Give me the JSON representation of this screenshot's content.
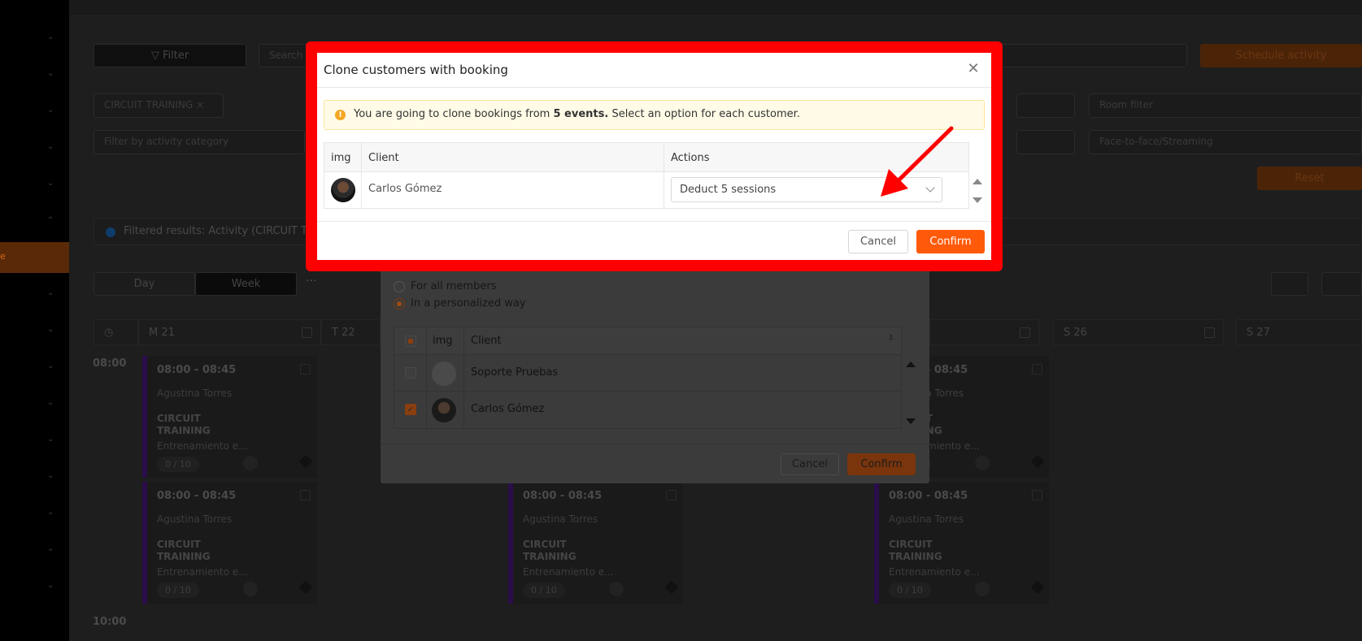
{
  "background": {
    "filter_button": "Filter",
    "search_placeholder": "Search",
    "schedule_button": "Schedule activity",
    "activity_chip": "CIRCUIT TRAINING ×",
    "category_placeholder": "Filter by activity category",
    "room_placeholder": "Room filter",
    "streaming_placeholder": "Face-to-face/Streaming",
    "reset_button": "Reset",
    "filtered_info": "Filtered results: Activity (CIRCUIT TRAINING)",
    "view_tabs": [
      "Day",
      "Week"
    ],
    "more_label": "···",
    "sidebar_active": "e",
    "day_headers": [
      "M 21",
      "T 22",
      "S 26",
      "S 27"
    ],
    "time_labels": [
      "08:00",
      "10:00"
    ],
    "event": {
      "time": "08:00 - 08:45",
      "trainer": "Agustina Torres",
      "title": "CIRCUIT TRAINING",
      "description": "Entrenamiento e...",
      "capacity": "0 / 10"
    }
  },
  "underlying_dialog": {
    "radio_all": "For all members",
    "radio_personalized": "In a personalized way",
    "columns": [
      "img",
      "Client"
    ],
    "rows": [
      {
        "client": "Soporte Pruebas",
        "checked": false
      },
      {
        "client": "Carlos Gómez",
        "checked": true
      }
    ],
    "cancel": "Cancel",
    "confirm": "Confirm"
  },
  "dialog": {
    "title": "Clone customers with booking",
    "close_icon": "close-icon",
    "alert_prefix": "You are going to clone bookings from ",
    "alert_bold": "5 events.",
    "alert_suffix": " Select an option for each customer.",
    "columns": {
      "img": "img",
      "client": "Client",
      "actions": "Actions"
    },
    "rows": [
      {
        "client": "Carlos Gómez",
        "action": "Deduct 5 sessions"
      }
    ],
    "cancel": "Cancel",
    "confirm": "Confirm"
  },
  "colors": {
    "highlight_frame": "#ff0000",
    "accent": "#ff5a0a",
    "alert_bg": "#fffbe6",
    "alert_icon": "#f5a623"
  }
}
